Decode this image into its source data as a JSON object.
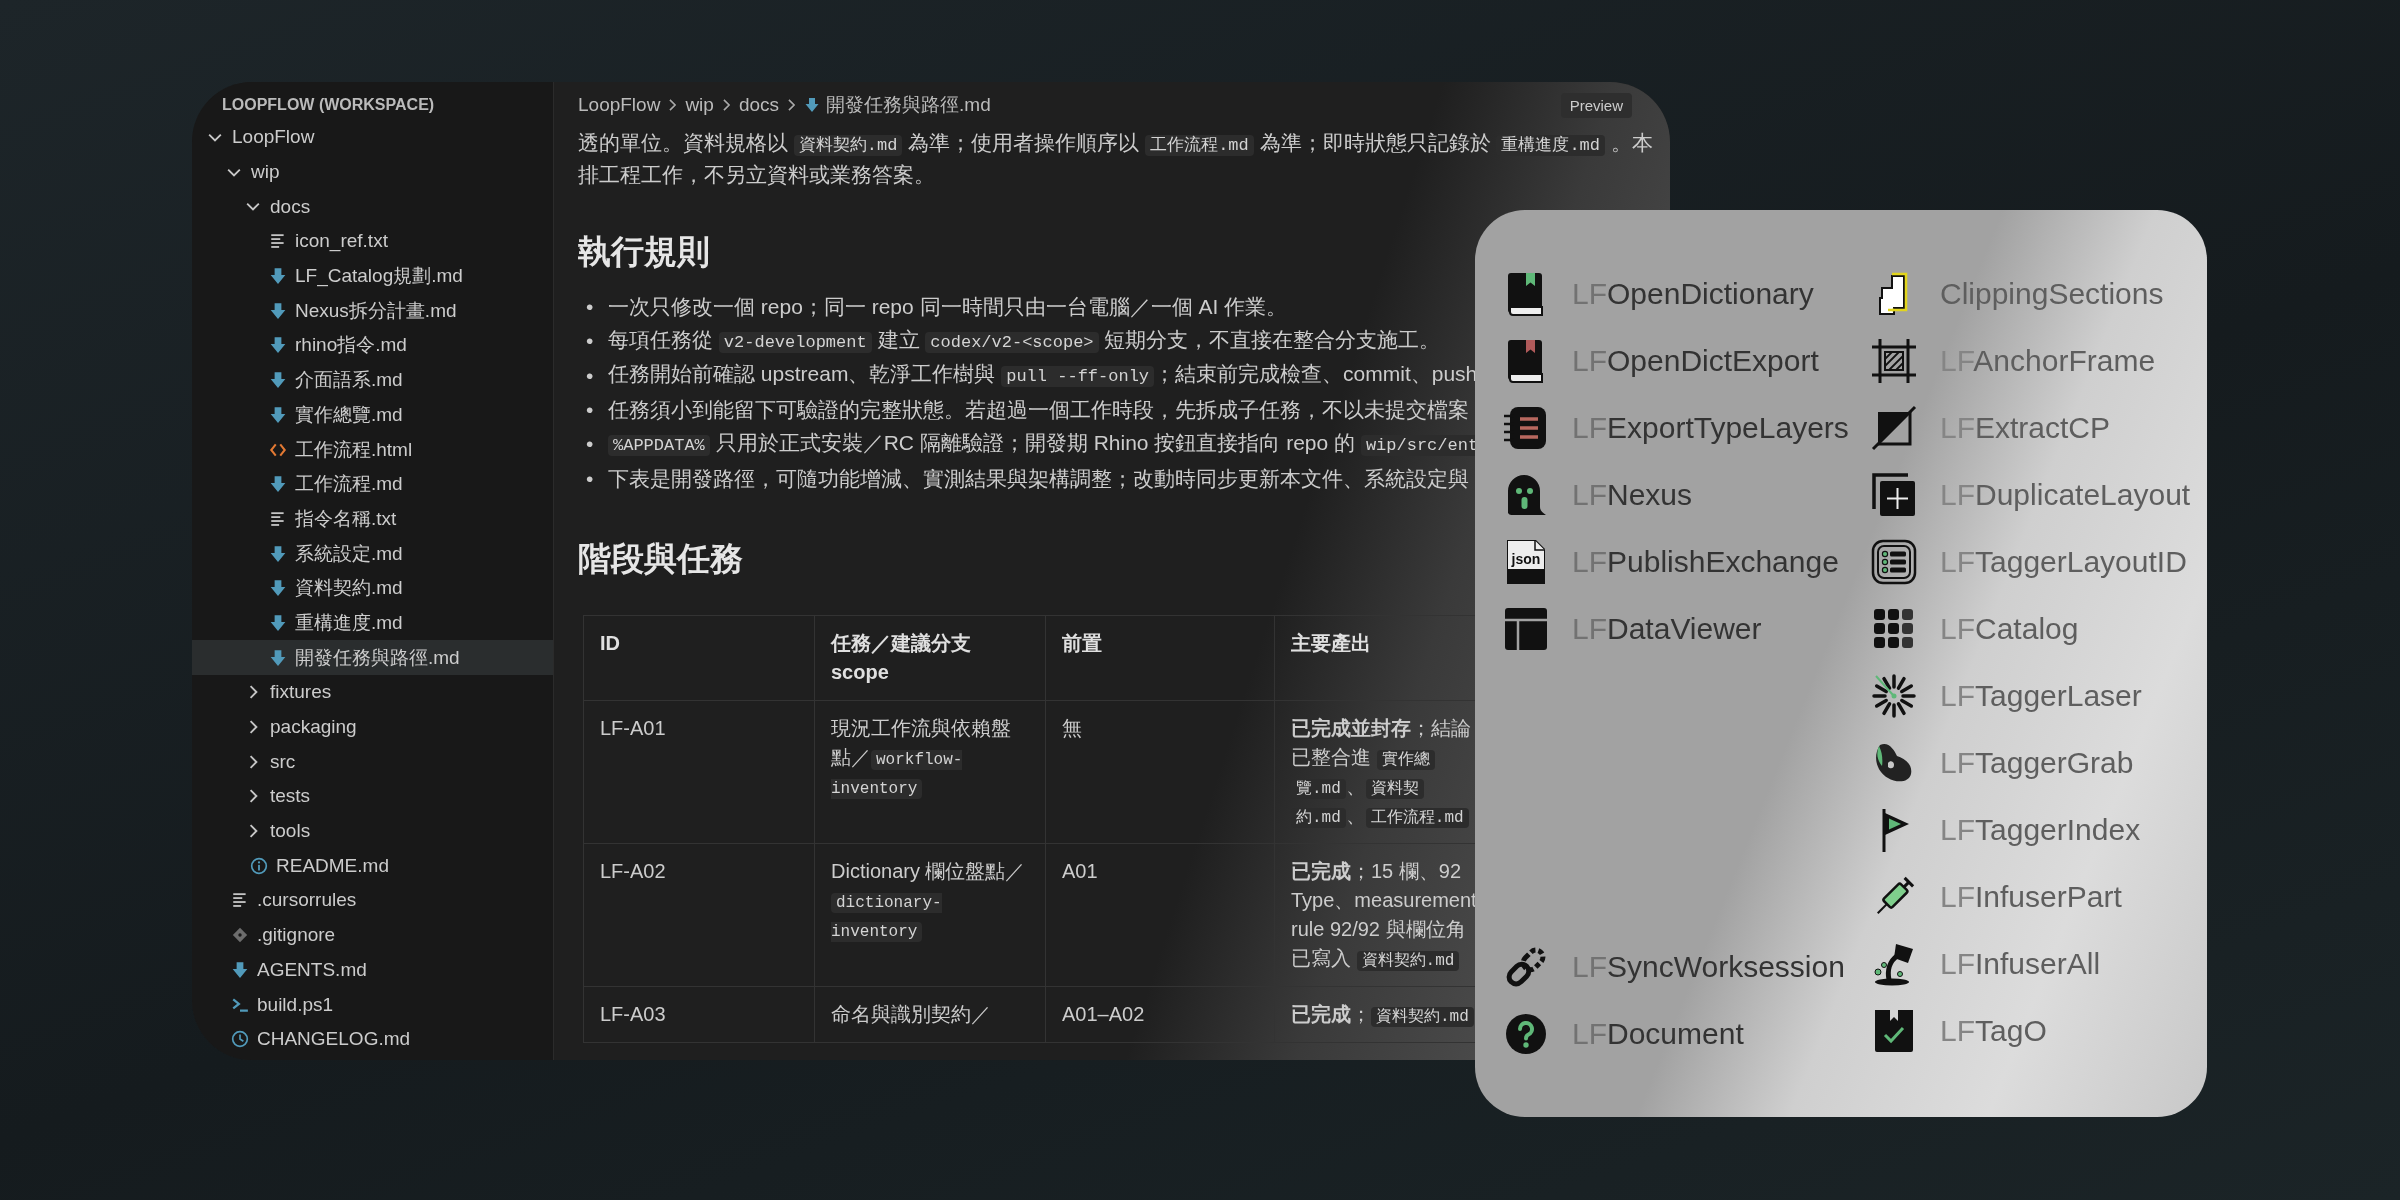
{
  "editor": {
    "sidebar": {
      "title": "LOOPFLOW (WORKSPACE)",
      "tree": [
        {
          "label": "LoopFlow",
          "kind": "folder",
          "expanded": true,
          "selected": false,
          "children": [
            {
              "label": "wip",
              "kind": "folder",
              "expanded": true,
              "selected": false,
              "children": [
                {
                  "label": "docs",
                  "kind": "folder",
                  "expanded": true,
                  "selected": false,
                  "children": [
                    {
                      "label": "icon_ref.txt",
                      "kind": "txt",
                      "selected": false
                    },
                    {
                      "label": "LF_Catalog規劃.md",
                      "kind": "md",
                      "selected": false
                    },
                    {
                      "label": "Nexus拆分計畫.md",
                      "kind": "md",
                      "selected": false
                    },
                    {
                      "label": "rhino指令.md",
                      "kind": "md",
                      "selected": false
                    },
                    {
                      "label": "介面語系.md",
                      "kind": "md",
                      "selected": false
                    },
                    {
                      "label": "實作總覽.md",
                      "kind": "md",
                      "selected": false
                    },
                    {
                      "label": "工作流程.html",
                      "kind": "html",
                      "selected": false
                    },
                    {
                      "label": "工作流程.md",
                      "kind": "md",
                      "selected": false
                    },
                    {
                      "label": "指令名稱.txt",
                      "kind": "txt",
                      "selected": false
                    },
                    {
                      "label": "系統設定.md",
                      "kind": "md",
                      "selected": false
                    },
                    {
                      "label": "資料契約.md",
                      "kind": "md",
                      "selected": false
                    },
                    {
                      "label": "重構進度.md",
                      "kind": "md",
                      "selected": false
                    },
                    {
                      "label": "開發任務與路徑.md",
                      "kind": "md",
                      "selected": true
                    }
                  ]
                },
                {
                  "label": "fixtures",
                  "kind": "folder",
                  "expanded": false,
                  "selected": false
                },
                {
                  "label": "packaging",
                  "kind": "folder",
                  "expanded": false,
                  "selected": false
                },
                {
                  "label": "src",
                  "kind": "folder",
                  "expanded": false,
                  "selected": false
                },
                {
                  "label": "tests",
                  "kind": "folder",
                  "expanded": false,
                  "selected": false
                },
                {
                  "label": "tools",
                  "kind": "folder",
                  "expanded": false,
                  "selected": false
                },
                {
                  "label": "README.md",
                  "kind": "info",
                  "selected": false
                }
              ]
            },
            {
              "label": ".cursorrules",
              "kind": "txt",
              "selected": false
            },
            {
              "label": ".gitignore",
              "kind": "git",
              "selected": false
            },
            {
              "label": "AGENTS.md",
              "kind": "md",
              "selected": false
            },
            {
              "label": "build.ps1",
              "kind": "shell",
              "selected": false
            },
            {
              "label": "CHANGELOG.md",
              "kind": "clock",
              "selected": false
            }
          ]
        }
      ]
    },
    "breadcrumb": [
      {
        "label": "LoopFlow",
        "kind": "folder"
      },
      {
        "label": "wip",
        "kind": "folder"
      },
      {
        "label": "docs",
        "kind": "folder"
      },
      {
        "label": "開發任務與路徑.md",
        "kind": "md"
      }
    ],
    "preview_button": "Preview",
    "document": {
      "intro_lines": [
        [
          {
            "kind": "text",
            "text": "透的單位。資料規格以 "
          },
          {
            "kind": "code",
            "text": "資料契約.md"
          },
          {
            "kind": "text",
            "text": " 為準；使用者操作順序以 "
          },
          {
            "kind": "code",
            "text": "工作流程.md"
          },
          {
            "kind": "text",
            "text": " 為準；即時狀態只記錄於 "
          },
          {
            "kind": "code",
            "text": "重構進度.md"
          },
          {
            "kind": "text",
            "text": " 。本"
          }
        ],
        [
          {
            "kind": "text",
            "text": "排工程工作，不另立資料或業務答案。"
          }
        ]
      ],
      "sections": [
        {
          "heading": "執行規則",
          "bullets": [
            {
              "marker": "•",
              "segments": [
                {
                  "kind": "text",
                  "text": "一次只修改一個 repo；同一 repo 同一時間只由一台電腦／一個 AI 作業。"
                }
              ]
            },
            {
              "marker": "•",
              "segments": [
                {
                  "kind": "text",
                  "text": "每項任務從 "
                },
                {
                  "kind": "code",
                  "text": "v2-development"
                },
                {
                  "kind": "text",
                  "text": " 建立 "
                },
                {
                  "kind": "code",
                  "text": "codex/v2-<scope>"
                },
                {
                  "kind": "text",
                  "text": " 短期分支，不直接在整合分支施工。"
                }
              ]
            },
            {
              "marker": "•",
              "segments": [
                {
                  "kind": "text",
                  "text": "任務開始前確認 upstream、乾淨工作樹與 "
                },
                {
                  "kind": "code",
                  "text": "pull --ff-only"
                },
                {
                  "kind": "text",
                  "text": "；結束前完成檢查、commit、push"
                }
              ]
            },
            {
              "marker": "•",
              "segments": [
                {
                  "kind": "text",
                  "text": "任務須小到能留下可驗證的完整狀態。若超過一個工作時段，先拆成子任務，不以未提交檔案"
                }
              ]
            },
            {
              "marker": "•",
              "segments": [
                {
                  "kind": "code",
                  "text": "%APPDATA%"
                },
                {
                  "kind": "text",
                  "text": " 只用於正式安裝／RC 隔離驗證；開發期 Rhino 按鈕直接指向 repo 的 "
                },
                {
                  "kind": "code",
                  "text": "wip/src/ent"
                }
              ]
            },
            {
              "marker": "•",
              "segments": [
                {
                  "kind": "text",
                  "text": "下表是開發路徑，可隨功能增減、實測結果與架構調整；改動時同步更新本文件、系統設定與"
                }
              ]
            }
          ]
        },
        {
          "heading": "階段與任務",
          "table": {
            "columns": [
              "ID",
              "任務／建議分支 scope",
              "前置",
              "主要產出"
            ],
            "rows": [
              [
                [
                  {
                    "kind": "text",
                    "text": "LF-A01"
                  }
                ],
                [
                  {
                    "kind": "text",
                    "text": "現況工作流與依賴盤點／"
                  },
                  {
                    "kind": "code",
                    "text": "workflow-inventory"
                  }
                ],
                [
                  {
                    "kind": "text",
                    "text": "無"
                  }
                ],
                {
                  "lines": [
                    [
                      {
                        "kind": "text",
                        "text": "**已完成並封存**；結論"
                      }
                    ],
                    [
                      {
                        "kind": "text",
                        "text": "已整合進 "
                      },
                      {
                        "kind": "code",
                        "text": "實作總"
                      }
                    ],
                    [
                      {
                        "kind": "code",
                        "text": "覽.md"
                      },
                      {
                        "kind": "text",
                        "text": "、"
                      },
                      {
                        "kind": "code",
                        "text": "資料契"
                      }
                    ],
                    [
                      {
                        "kind": "code",
                        "text": "約.md"
                      },
                      {
                        "kind": "text",
                        "text": "、"
                      },
                      {
                        "kind": "code",
                        "text": "工作流程.md"
                      }
                    ]
                  ]
                }
              ],
              [
                [
                  {
                    "kind": "text",
                    "text": "LF-A02"
                  }
                ],
                [
                  {
                    "kind": "text",
                    "text": "Dictionary 欄位盤點／"
                  },
                  {
                    "kind": "code",
                    "text": "dictionary-inventory"
                  }
                ],
                [
                  {
                    "kind": "text",
                    "text": "A01"
                  }
                ],
                {
                  "lines": [
                    [
                      {
                        "kind": "text",
                        "text": "**已完成**；15 欄、92"
                      }
                    ],
                    [
                      {
                        "kind": "text",
                        "text": "Type、measurement"
                      }
                    ],
                    [
                      {
                        "kind": "text",
                        "text": "rule 92/92 與欄位角"
                      }
                    ],
                    [
                      {
                        "kind": "text",
                        "text": "已寫入 "
                      },
                      {
                        "kind": "code",
                        "text": "資料契約.md"
                      }
                    ]
                  ]
                }
              ],
              [
                [
                  {
                    "kind": "text",
                    "text": "LF-A03"
                  }
                ],
                [
                  {
                    "kind": "text",
                    "text": "命名與識別契約／"
                  }
                ],
                [
                  {
                    "kind": "text",
                    "text": "A01–A02"
                  }
                ],
                {
                  "lines": [
                    [
                      {
                        "kind": "text",
                        "text": "**已完成**；"
                      },
                      {
                        "kind": "code",
                        "text": "資料契約.md"
                      }
                    ]
                  ]
                }
              ]
            ]
          }
        }
      ]
    }
  },
  "command_panel": {
    "columns": [
      {
        "groups": [
          [
            {
              "prefix": "LF",
              "name": "OpenDictionary",
              "kind": "book-green"
            },
            {
              "prefix": "LF",
              "name": "OpenDictExport",
              "kind": "book-red"
            },
            {
              "prefix": "LF",
              "name": "ExportTypeLayers",
              "kind": "notebook"
            },
            {
              "prefix": "LF",
              "name": "Nexus",
              "kind": "ghost"
            },
            {
              "prefix": "LF",
              "name": "PublishExchange",
              "kind": "json-file",
              "icon_text": "json"
            },
            {
              "prefix": "LF",
              "name": "DataViewer",
              "kind": "table"
            }
          ],
          [
            {
              "prefix": "LF",
              "name": "SyncWorksession",
              "kind": "link"
            },
            {
              "prefix": "LF",
              "name": "Document",
              "kind": "help"
            }
          ]
        ]
      },
      {
        "groups": [
          [
            {
              "name": "ClippingSections",
              "kind": "stacked"
            },
            {
              "prefix": "LF",
              "name": "AnchorFrame",
              "kind": "frame"
            },
            {
              "prefix": "LF",
              "name": "ExtractCP",
              "kind": "triangle"
            },
            {
              "prefix": "LF",
              "name": "DuplicateLayout",
              "kind": "duplicate"
            },
            {
              "prefix": "LF",
              "name": "TaggerLayoutID",
              "kind": "list"
            },
            {
              "prefix": "LF",
              "name": "Catalog",
              "kind": "dots"
            },
            {
              "prefix": "LF",
              "name": "TaggerLaser",
              "kind": "burst"
            },
            {
              "prefix": "LF",
              "name": "TaggerGrab",
              "kind": "blob"
            },
            {
              "prefix": "LF",
              "name": "TaggerIndex",
              "kind": "flag"
            },
            {
              "prefix": "LF",
              "name": "InfuserPart",
              "kind": "syringe"
            },
            {
              "prefix": "LF",
              "name": "InfuserAll",
              "kind": "pour"
            },
            {
              "prefix": "LF",
              "name": "TagO",
              "kind": "check-tag"
            }
          ]
        ]
      }
    ]
  }
}
